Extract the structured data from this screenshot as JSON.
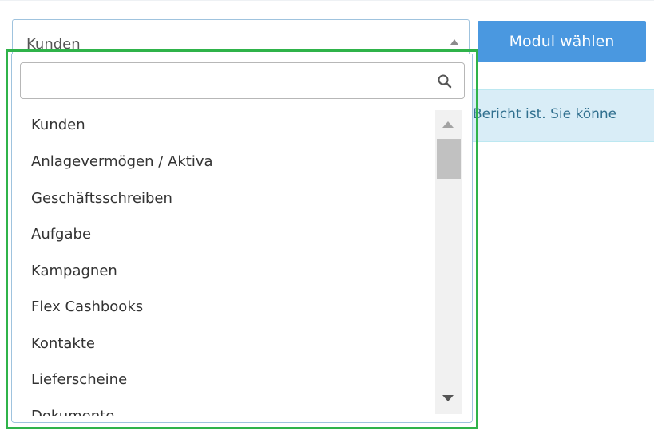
{
  "select": {
    "value": "Kunden"
  },
  "button": {
    "label": "Modul wählen"
  },
  "info": {
    "text": "Bericht ist. Sie könne"
  },
  "dropdown": {
    "search_value": "",
    "search_placeholder": "",
    "options": [
      "Kunden",
      "Anlagevermögen / Aktiva",
      "Geschäftsschreiben",
      "Aufgabe",
      "Kampagnen",
      "Flex Cashbooks",
      "Kontakte",
      "Lieferscheine",
      "Dokumente"
    ]
  },
  "colors": {
    "highlight": "#2fb34a",
    "button": "#4a98e0",
    "info_bg": "#d9edf7"
  },
  "icons": [
    "search-icon",
    "caret-up-icon",
    "scroll-up-arrow-icon",
    "scroll-down-arrow-icon"
  ]
}
